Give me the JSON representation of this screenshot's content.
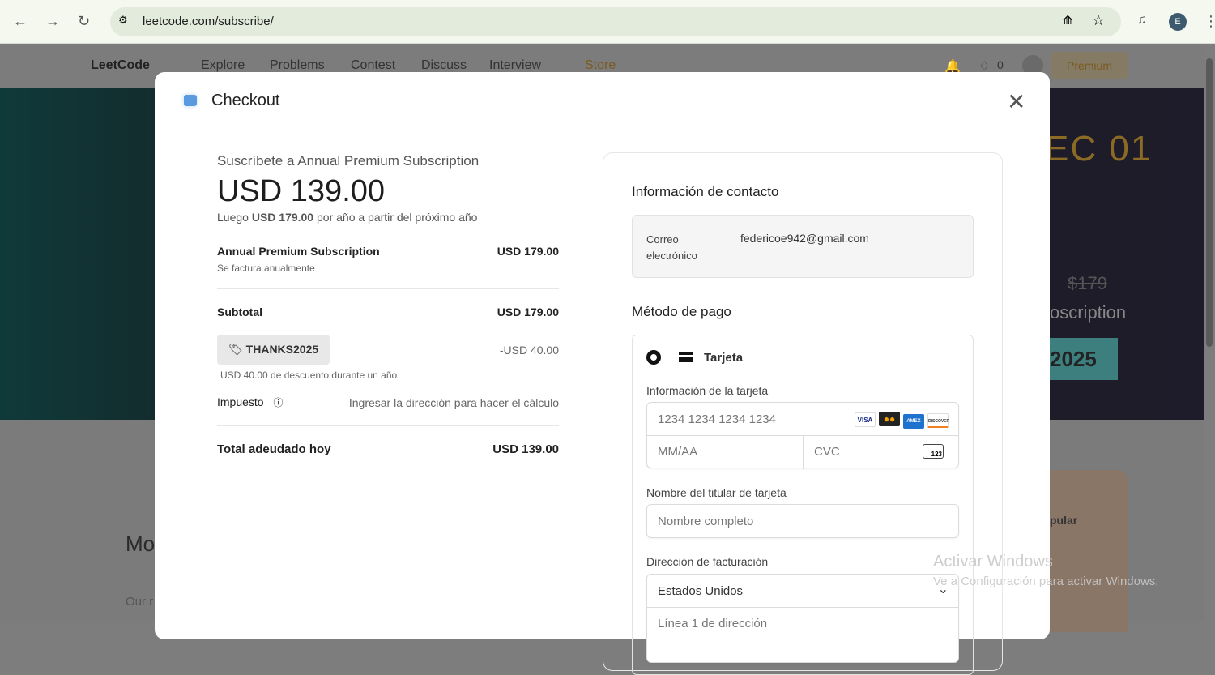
{
  "browser": {
    "url": "leetcode.com/subscribe/",
    "profile_initial": "E"
  },
  "site_nav": {
    "logo": "LeetCode",
    "items": [
      "Explore",
      "Problems",
      "Contest",
      "Discuss",
      "Interview",
      "Store"
    ],
    "streak": "0",
    "premium": "Premium"
  },
  "background": {
    "banner_date": "EC 01",
    "old_price": "$179",
    "subscription_fragment": "oscription",
    "code_fragment": "2025",
    "popular_fragment": "pular",
    "heading_fragment": "Mo",
    "text_fragment": "Our r"
  },
  "modal": {
    "title": "Checkout",
    "summary": {
      "subscribe_line": "Suscríbete a Annual Premium Subscription",
      "price": "USD 139.00",
      "then_prefix": "Luego",
      "then_amount": "USD 179.00",
      "then_suffix": "por año a partir del próximo año",
      "item_name": "Annual Premium Subscription",
      "item_price": "USD 179.00",
      "item_billing": "Se factura anualmente",
      "subtotal_label": "Subtotal",
      "subtotal": "USD 179.00",
      "coupon": "THANKS2025",
      "coupon_amount": "-USD 40.00",
      "coupon_desc": "USD 40.00 de descuento durante un año",
      "tax_label": "Impuesto",
      "tax_value": "Ingresar la dirección para hacer el cálculo",
      "total_label": "Total adeudado hoy",
      "total": "USD 139.00"
    },
    "form": {
      "contact_heading": "Información de contacto",
      "email_label": "Correo electrónico",
      "email": "federicoe942@gmail.com",
      "payment_heading": "Método de pago",
      "method": "Tarjeta",
      "card_info_label": "Información de la tarjeta",
      "card_number_placeholder": "1234 1234 1234 1234",
      "expiry_placeholder": "MM/AA",
      "cvc_placeholder": "CVC",
      "cvc_icon_text": "123",
      "brands": [
        "VISA",
        "MC",
        "AMEX",
        "DISCOVER"
      ],
      "holder_label": "Nombre del titular de tarjeta",
      "holder_placeholder": "Nombre completo",
      "billing_label": "Dirección de facturación",
      "country": "Estados Unidos",
      "address_placeholder": "Línea 1 de dirección"
    }
  },
  "watermark": {
    "title": "Activar Windows",
    "subtitle": "Ve a Configuración para activar Windows."
  }
}
